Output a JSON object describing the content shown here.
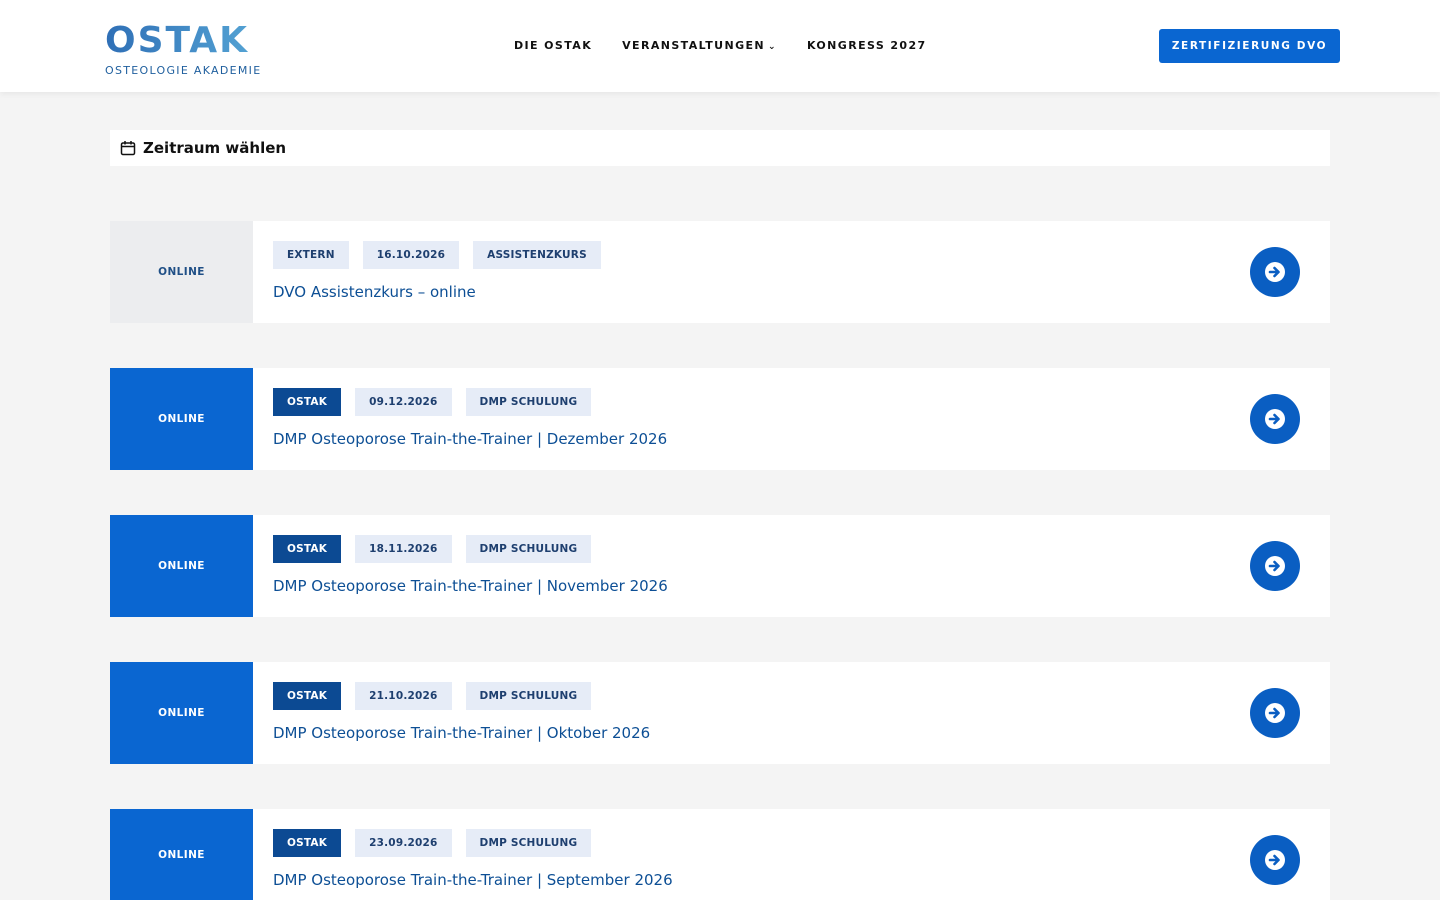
{
  "header": {
    "logo_word": "OSTAK",
    "logo_sub": "OSTEOLOGIE AKADEMIE",
    "nav": [
      {
        "label": "DIE OSTAK"
      },
      {
        "label": "VERANSTALTUNGEN",
        "chevron": "⌄"
      },
      {
        "label": "KONGRESS 2027"
      }
    ],
    "cta_label": "ZERTIFIZIERUNG DVO"
  },
  "filter": {
    "label": "Zeitraum wählen",
    "icon": "calendar-icon"
  },
  "events": [
    {
      "format": "ONLINE",
      "organizer": "EXTERN",
      "date": "16.10.2026",
      "category": "ASSISTENZKURS",
      "title": "DVO Assistenzkurs – online"
    },
    {
      "format": "ONLINE",
      "organizer": "OSTAK",
      "date": "09.12.2026",
      "category": "DMP SCHULUNG",
      "title": "DMP Osteoporose Train-the-Trainer | Dezember 2026"
    },
    {
      "format": "ONLINE",
      "organizer": "OSTAK",
      "date": "18.11.2026",
      "category": "DMP SCHULUNG",
      "title": "DMP Osteoporose Train-the-Trainer | November 2026"
    },
    {
      "format": "ONLINE",
      "organizer": "OSTAK",
      "date": "21.10.2026",
      "category": "DMP SCHULUNG",
      "title": "DMP Osteoporose Train-the-Trainer | Oktober 2026"
    },
    {
      "format": "ONLINE",
      "organizer": "OSTAK",
      "date": "23.09.2026",
      "category": "DMP SCHULUNG",
      "title": "DMP Osteoporose Train-the-Trainer | September 2026"
    }
  ],
  "colors": {
    "primary": "#0a66d1",
    "dark_tag": "#0c4a93",
    "light_tag": "#e6ecf7",
    "title": "#0d4f95",
    "background": "#f4f4f4"
  }
}
